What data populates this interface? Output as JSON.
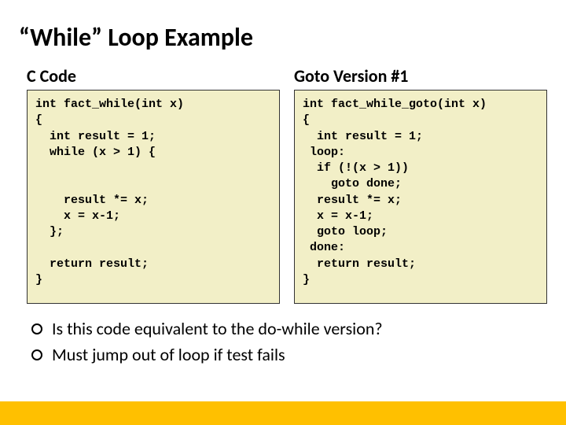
{
  "title": "“While” Loop Example",
  "left": {
    "header": "C Code",
    "code": "int fact_while(int x)\n{\n  int result = 1;\n  while (x > 1) {\n\n\n    result *= x;\n    x = x-1;\n  };\n\n  return result;\n}"
  },
  "right": {
    "header": "Goto Version #1",
    "code": "int fact_while_goto(int x)\n{\n  int result = 1;\n loop:\n  if (!(x > 1))\n    goto done;\n  result *= x;\n  x = x-1;\n  goto loop;\n done:\n  return result;\n}"
  },
  "bullets": [
    "Is this code equivalent to the do-while version?",
    "Must jump out of loop if test fails"
  ]
}
